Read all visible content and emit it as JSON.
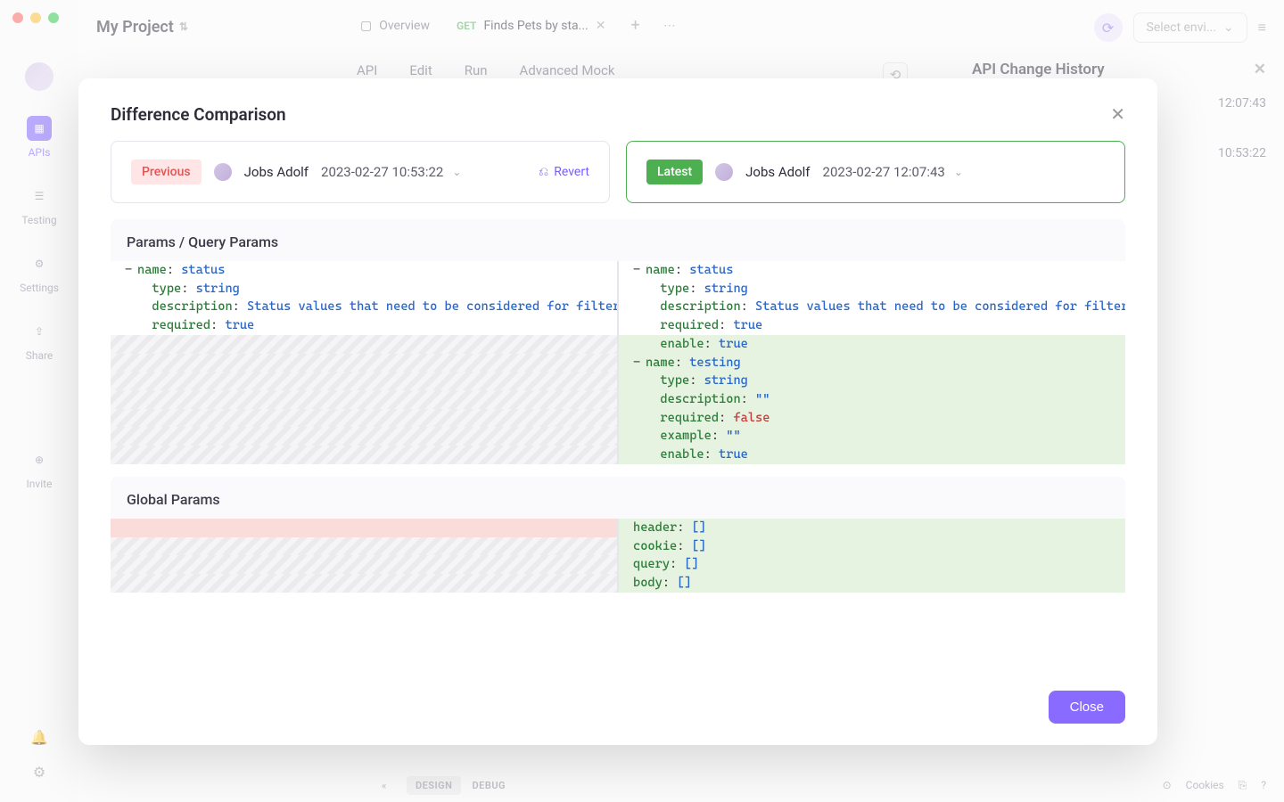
{
  "window": {
    "project_title": "My Project"
  },
  "sidebar": {
    "items": [
      {
        "label": "APIs"
      },
      {
        "label": "Testing"
      },
      {
        "label": "Settings"
      },
      {
        "label": "Share"
      },
      {
        "label": "Invite"
      }
    ]
  },
  "tabs": {
    "overview": "Overview",
    "active": {
      "method": "GET",
      "title": "Finds Pets by sta..."
    }
  },
  "subtabs": [
    "API",
    "Edit",
    "Run",
    "Advanced Mock"
  ],
  "top_right": {
    "env_placeholder": "Select envi..."
  },
  "history_panel": {
    "title": "API Change History",
    "rows": [
      "12:07:43",
      "10:53:22"
    ]
  },
  "modal": {
    "title": "Difference Comparison",
    "close_label": "Close",
    "previous": {
      "badge": "Previous",
      "user": "Jobs Adolf",
      "timestamp": "2023-02-27 10:53:22",
      "revert": "Revert"
    },
    "latest": {
      "badge": "Latest",
      "user": "Jobs Adolf",
      "timestamp": "2023-02-27 12:07:43"
    },
    "sections": {
      "params_title": "Params / Query Params",
      "global_title": "Global Params"
    },
    "diff_left": [
      {
        "k": "name",
        "v": "status",
        "t": "str",
        "dash": true
      },
      {
        "k": "type",
        "v": "string",
        "t": "str"
      },
      {
        "k": "description",
        "v": "Status values that need to be considered for filter",
        "t": "str"
      },
      {
        "k": "required",
        "v": "true",
        "t": "bool"
      }
    ],
    "diff_right": [
      {
        "k": "name",
        "v": "status",
        "t": "str",
        "dash": true,
        "cls": ""
      },
      {
        "k": "type",
        "v": "string",
        "t": "str",
        "cls": ""
      },
      {
        "k": "description",
        "v": "Status values that need to be considered for filter",
        "t": "str",
        "cls": ""
      },
      {
        "k": "required",
        "v": "true",
        "t": "bool",
        "cls": ""
      },
      {
        "k": "enable",
        "v": "true",
        "t": "bool",
        "cls": "added-bg"
      },
      {
        "k": "name",
        "v": "testing",
        "t": "str",
        "dash": true,
        "cls": "added-bg"
      },
      {
        "k": "type",
        "v": "string",
        "t": "str",
        "cls": "added-bg"
      },
      {
        "k": "description",
        "v": "\"\"",
        "t": "str",
        "cls": "added-bg"
      },
      {
        "k": "required",
        "v": "false",
        "t": "boolf",
        "cls": "added-bg"
      },
      {
        "k": "example",
        "v": "\"\"",
        "t": "str",
        "cls": "added-bg"
      },
      {
        "k": "enable",
        "v": "true",
        "t": "bool",
        "cls": "added-bg"
      }
    ],
    "global_right": [
      {
        "k": "header",
        "v": "[]"
      },
      {
        "k": "cookie",
        "v": "[]"
      },
      {
        "k": "query",
        "v": "[]"
      },
      {
        "k": "body",
        "v": "[]"
      }
    ]
  },
  "bottom_bar": {
    "design": "DESIGN",
    "debug": "DEBUG",
    "cookies": "Cookies"
  }
}
